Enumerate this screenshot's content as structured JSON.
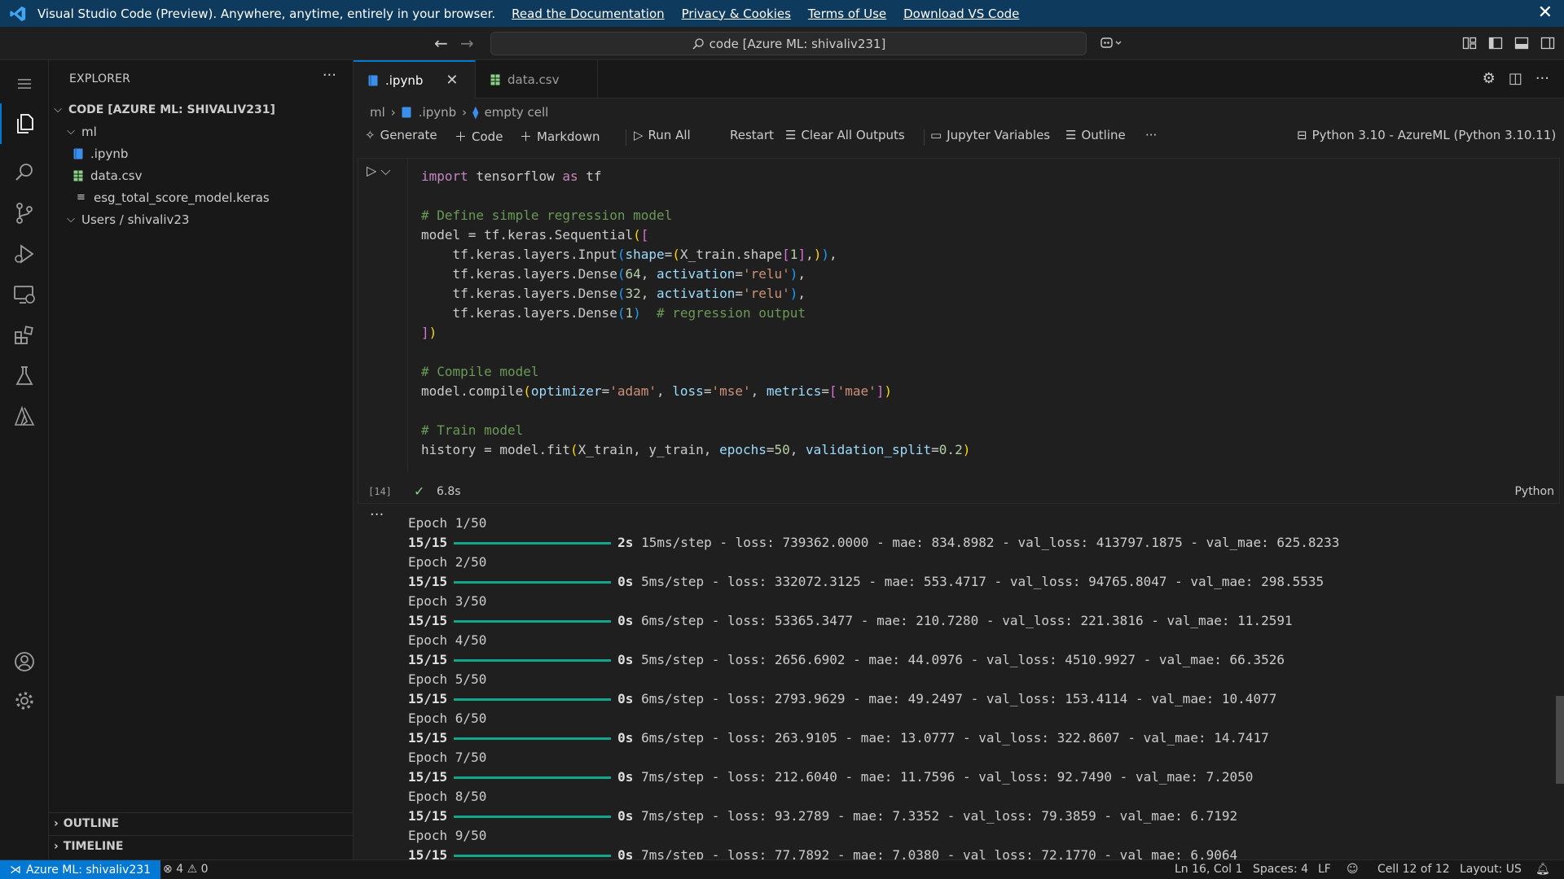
{
  "banner": {
    "title": "Visual Studio Code (Preview). Anywhere, anytime, entirely in your browser.",
    "links": [
      "Read the Documentation",
      "Privacy & Cookies",
      "Terms of Use",
      "Download VS Code"
    ],
    "close": "✕"
  },
  "titlebar": {
    "search_text": "code [Azure ML: shivaliv231]"
  },
  "sidebar": {
    "title": "EXPLORER",
    "root": "CODE [AZURE ML: SHIVALIV231]",
    "tree": [
      {
        "label": "ml",
        "type": "folder"
      },
      {
        "label": ".ipynb",
        "type": "notebook"
      },
      {
        "label": "data.csv",
        "type": "csv"
      },
      {
        "label": "esg_total_score_model.keras",
        "type": "file"
      },
      {
        "label": "Users / shivaliv23",
        "type": "folder"
      }
    ],
    "sections": [
      "OUTLINE",
      "TIMELINE"
    ]
  },
  "tabs": [
    {
      "label": ".ipynb",
      "active": true
    },
    {
      "label": "data.csv",
      "active": false
    }
  ],
  "breadcrumb": [
    "ml",
    ".ipynb",
    "empty cell"
  ],
  "toolbar": {
    "generate": "Generate",
    "code": "Code",
    "markdown": "Markdown",
    "run_all": "Run All",
    "restart": "Restart",
    "clear_outputs": "Clear All Outputs",
    "jupyter_vars": "Jupyter Variables",
    "outline": "Outline",
    "kernel": "Python 3.10 - AzureML (Python 3.10.11)"
  },
  "cell": {
    "exec_count": "[14]",
    "duration": "6.8s",
    "language": "Python"
  },
  "output": {
    "more": "···",
    "epochs": [
      {
        "epoch": "Epoch 1/50",
        "step": "15/15",
        "time": "2s",
        "rest": "15ms/step - loss: 739362.0000 - mae: 834.8982 - val_loss: 413797.1875 - val_mae: 625.8233"
      },
      {
        "epoch": "Epoch 2/50",
        "step": "15/15",
        "time": "0s",
        "rest": "5ms/step - loss: 332072.3125 - mae: 553.4717 - val_loss: 94765.8047 - val_mae: 298.5535"
      },
      {
        "epoch": "Epoch 3/50",
        "step": "15/15",
        "time": "0s",
        "rest": "6ms/step - loss: 53365.3477 - mae: 210.7280 - val_loss: 221.3816 - val_mae: 11.2591"
      },
      {
        "epoch": "Epoch 4/50",
        "step": "15/15",
        "time": "0s",
        "rest": "5ms/step - loss: 2656.6902 - mae: 44.0976 - val_loss: 4510.9927 - val_mae: 66.3526"
      },
      {
        "epoch": "Epoch 5/50",
        "step": "15/15",
        "time": "0s",
        "rest": "6ms/step - loss: 2793.9629 - mae: 49.2497 - val_loss: 153.4114 - val_mae: 10.4077"
      },
      {
        "epoch": "Epoch 6/50",
        "step": "15/15",
        "time": "0s",
        "rest": "6ms/step - loss: 263.9105 - mae: 13.0777 - val_loss: 322.8607 - val_mae: 14.7417"
      },
      {
        "epoch": "Epoch 7/50",
        "step": "15/15",
        "time": "0s",
        "rest": "7ms/step - loss: 212.6040 - mae: 11.7596 - val_loss: 92.7490 - val_mae: 7.2050"
      },
      {
        "epoch": "Epoch 8/50",
        "step": "15/15",
        "time": "0s",
        "rest": "7ms/step - loss: 93.2789 - mae: 7.3352 - val_loss: 79.3859 - val_mae: 6.7192"
      },
      {
        "epoch": "Epoch 9/50",
        "step": "15/15",
        "time": "0s",
        "rest": "7ms/step - loss: 77.7892 - mae: 7.0380 - val_loss: 72.1770 - val_mae: 6.9064"
      }
    ]
  },
  "statusbar": {
    "remote": "Azure ML: shivaliv231",
    "errors": "4",
    "warnings": "0",
    "position": "Ln 16, Col 1",
    "spaces": "Spaces: 4",
    "eol": "LF",
    "cell": "Cell 12 of 12",
    "layout": "Layout: US"
  },
  "colors": {
    "banner_bg": "#0e3a5e",
    "accent": "#0078d4",
    "progress": "#11a88a"
  }
}
